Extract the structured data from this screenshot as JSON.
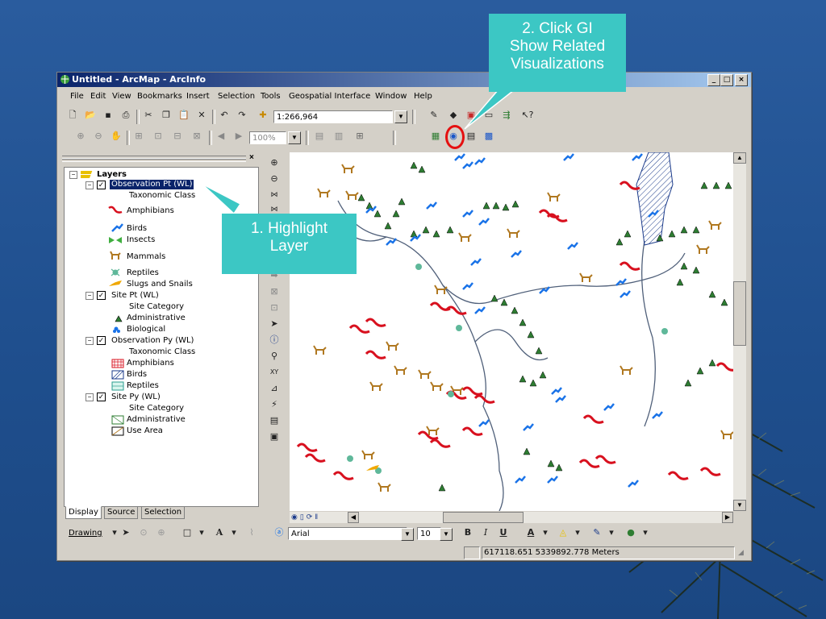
{
  "window": {
    "title": "Untitled - ArcMap - ArcInfo"
  },
  "menubar": [
    "File",
    "Edit",
    "View",
    "Bookmarks",
    "Insert",
    "Selection",
    "Tools",
    "Geospatial Interface",
    "Window",
    "Help"
  ],
  "toolbar": {
    "scale_value": "1:266,964",
    "zoom_value": "100%"
  },
  "toc": {
    "rows": [
      {
        "text": "Layers",
        "bold": true
      },
      {
        "text": "Observation Pt (WL)",
        "selected": true
      },
      {
        "text": "Taxonomic Class"
      },
      {
        "text": "Amphibians"
      },
      {
        "text": "Birds"
      },
      {
        "text": "Insects"
      },
      {
        "text": "Mammals"
      },
      {
        "text": "Reptiles"
      },
      {
        "text": "Slugs and Snails"
      },
      {
        "text": "Site Pt (WL)"
      },
      {
        "text": "Site Category"
      },
      {
        "text": "Administrative"
      },
      {
        "text": "Biological"
      },
      {
        "text": "Observation Py (WL)"
      },
      {
        "text": "Taxonomic Class"
      },
      {
        "text": "Amphibians"
      },
      {
        "text": "Birds"
      },
      {
        "text": "Reptiles"
      },
      {
        "text": "Site Py (WL)"
      },
      {
        "text": "Site Category"
      },
      {
        "text": "Administrative"
      },
      {
        "text": "Use Area"
      }
    ],
    "tabs": [
      "Display",
      "Source",
      "Selection"
    ]
  },
  "drawing_toolbar": {
    "drawing_label": "Drawing",
    "font_name": "Arial",
    "font_size": "10"
  },
  "status": {
    "coordinates": "617118.651  5339892.778 Meters"
  },
  "callouts": {
    "step1": [
      "1.  Highlight",
      "Layer"
    ],
    "step2": [
      "2.  Click GI",
      "Show Related",
      "Visualizations"
    ]
  },
  "colors": {
    "callout": "#3cc7c4",
    "title_active": "#0a246a",
    "highlight": "#e51010",
    "amphibian": "#d8101e",
    "bird": "#1a73e8",
    "mammal": "#b07820",
    "site": "#2e7d32"
  }
}
